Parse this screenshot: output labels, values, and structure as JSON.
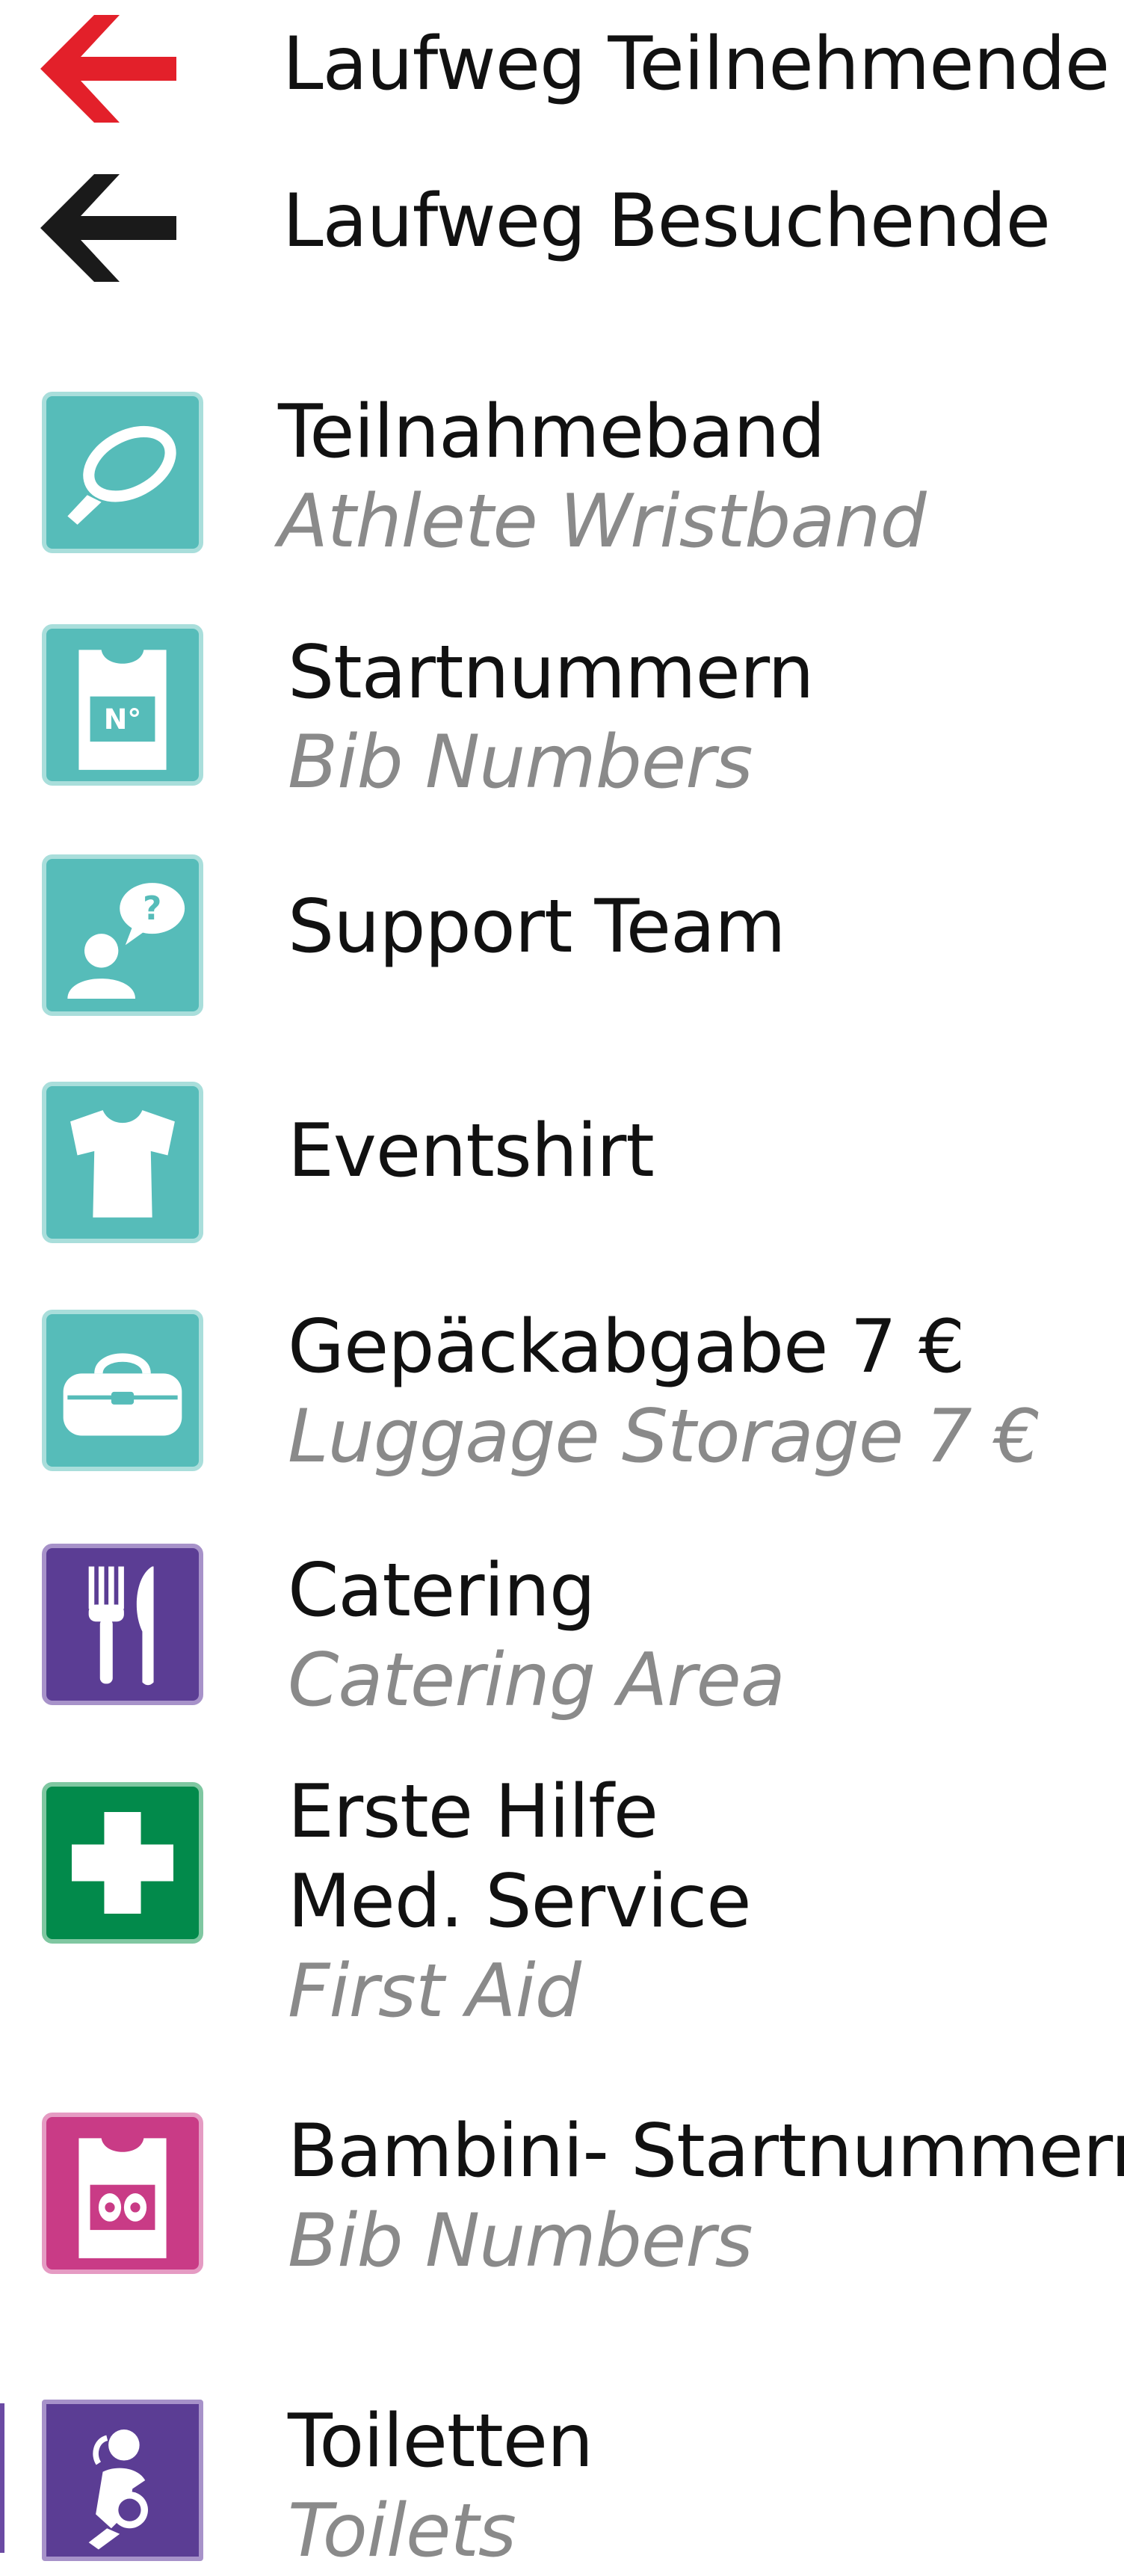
{
  "legend": {
    "arrows": [
      {
        "label": "Laufweg Teilnehmende",
        "color": "#e3202a",
        "icon": "arrow-left-icon"
      },
      {
        "label": "Laufweg Besuchende",
        "color": "#1a1a1a",
        "icon": "arrow-left-icon"
      }
    ],
    "items": [
      {
        "de": "Teilnahmeband",
        "en": "Athlete Wristband",
        "icon": "wristband-icon",
        "color": "#56bcb9"
      },
      {
        "de": "Startnummern",
        "en": "Bib Numbers",
        "icon": "bib-number-icon",
        "color": "#56bcb9"
      },
      {
        "de": "Support Team",
        "icon": "support-person-icon",
        "color": "#56bcb9"
      },
      {
        "de": "Eventshirt",
        "icon": "tshirt-icon",
        "color": "#56bcb9"
      },
      {
        "de": "Gepäckabgabe 7 €",
        "en": "Luggage Storage 7 €",
        "icon": "luggage-bag-icon",
        "color": "#56bcb9"
      },
      {
        "de": "Catering",
        "en": "Catering Area",
        "icon": "fork-knife-icon",
        "color": "#5b3d94"
      },
      {
        "de": "Erste Hilfe",
        "de2": "Med. Service",
        "en": "First Aid",
        "icon": "first-aid-cross-icon",
        "color": "#028a4b"
      },
      {
        "de": "Bambini- Startnummern",
        "en": "Bib Numbers",
        "icon": "bambini-bib-icon",
        "color": "#c93b86"
      },
      {
        "de": "Toiletten",
        "en": "Toilets",
        "icon": "toilet-baby-change-icon",
        "color": "#5b3d94"
      }
    ]
  }
}
